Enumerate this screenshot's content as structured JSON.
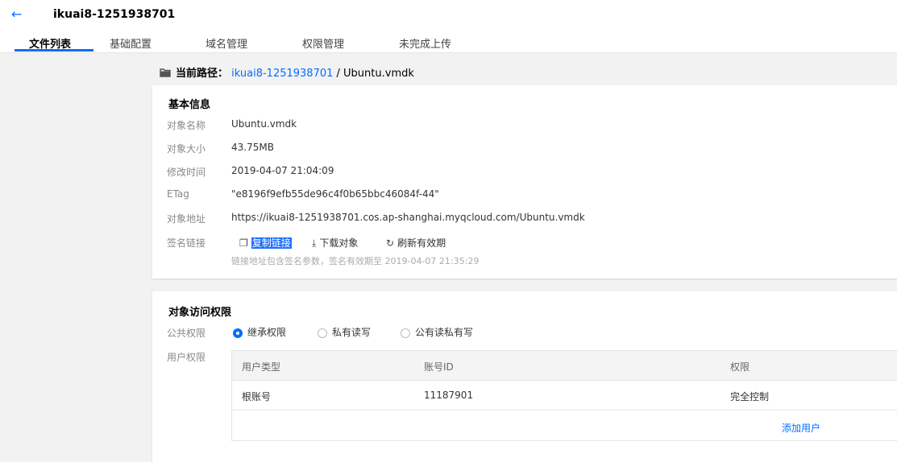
{
  "header": {
    "back_icon": "arrow-left-icon",
    "title": "ikuai8-1251938701"
  },
  "tabs": [
    {
      "label": "文件列表",
      "active": true
    },
    {
      "label": "基础配置",
      "active": false
    },
    {
      "label": "域名管理",
      "active": false
    },
    {
      "label": "权限管理",
      "active": false
    },
    {
      "label": "未完成上传",
      "active": false
    }
  ],
  "path": {
    "icon": "folder-icon",
    "label": "当前路径：",
    "bucket_link": "ikuai8-1251938701",
    "rest": " / Ubuntu.vmdk"
  },
  "basic_info": {
    "title": "基本信息",
    "rows": [
      {
        "label": "对象名称",
        "value": "Ubuntu.vmdk"
      },
      {
        "label": "对象大小",
        "value": "43.75MB"
      },
      {
        "label": "修改时间",
        "value": "2019-04-07 21:04:09"
      },
      {
        "label": "ETag",
        "value": "\"e8196f9efb55de96c4f0b65bbc46084f-44\""
      },
      {
        "label": "对象地址",
        "value": "https://ikuai8-1251938701.cos.ap-shanghai.myqcloud.com/Ubuntu.vmdk"
      }
    ],
    "sign_link": {
      "label": "签名链接",
      "copy": "复制链接",
      "download": "下载对象",
      "refresh": "刷新有效期",
      "hint": "链接地址包含签名参数，签名有效期至 2019-04-07 21:35:29"
    }
  },
  "access": {
    "title": "对象访问权限",
    "public_label": "公共权限",
    "options": [
      {
        "label": "继承权限",
        "checked": true
      },
      {
        "label": "私有读写",
        "checked": false
      },
      {
        "label": "公有读私有写",
        "checked": false
      }
    ],
    "user_label": "用户权限",
    "table": {
      "headers": [
        "用户类型",
        "账号ID",
        "权限"
      ],
      "rows": [
        [
          "根账号",
          "11187901",
          "完全控制"
        ]
      ],
      "add_user": "添加用户"
    }
  },
  "colors": {
    "accent": "#006eff",
    "background": "#f2f2f2"
  }
}
